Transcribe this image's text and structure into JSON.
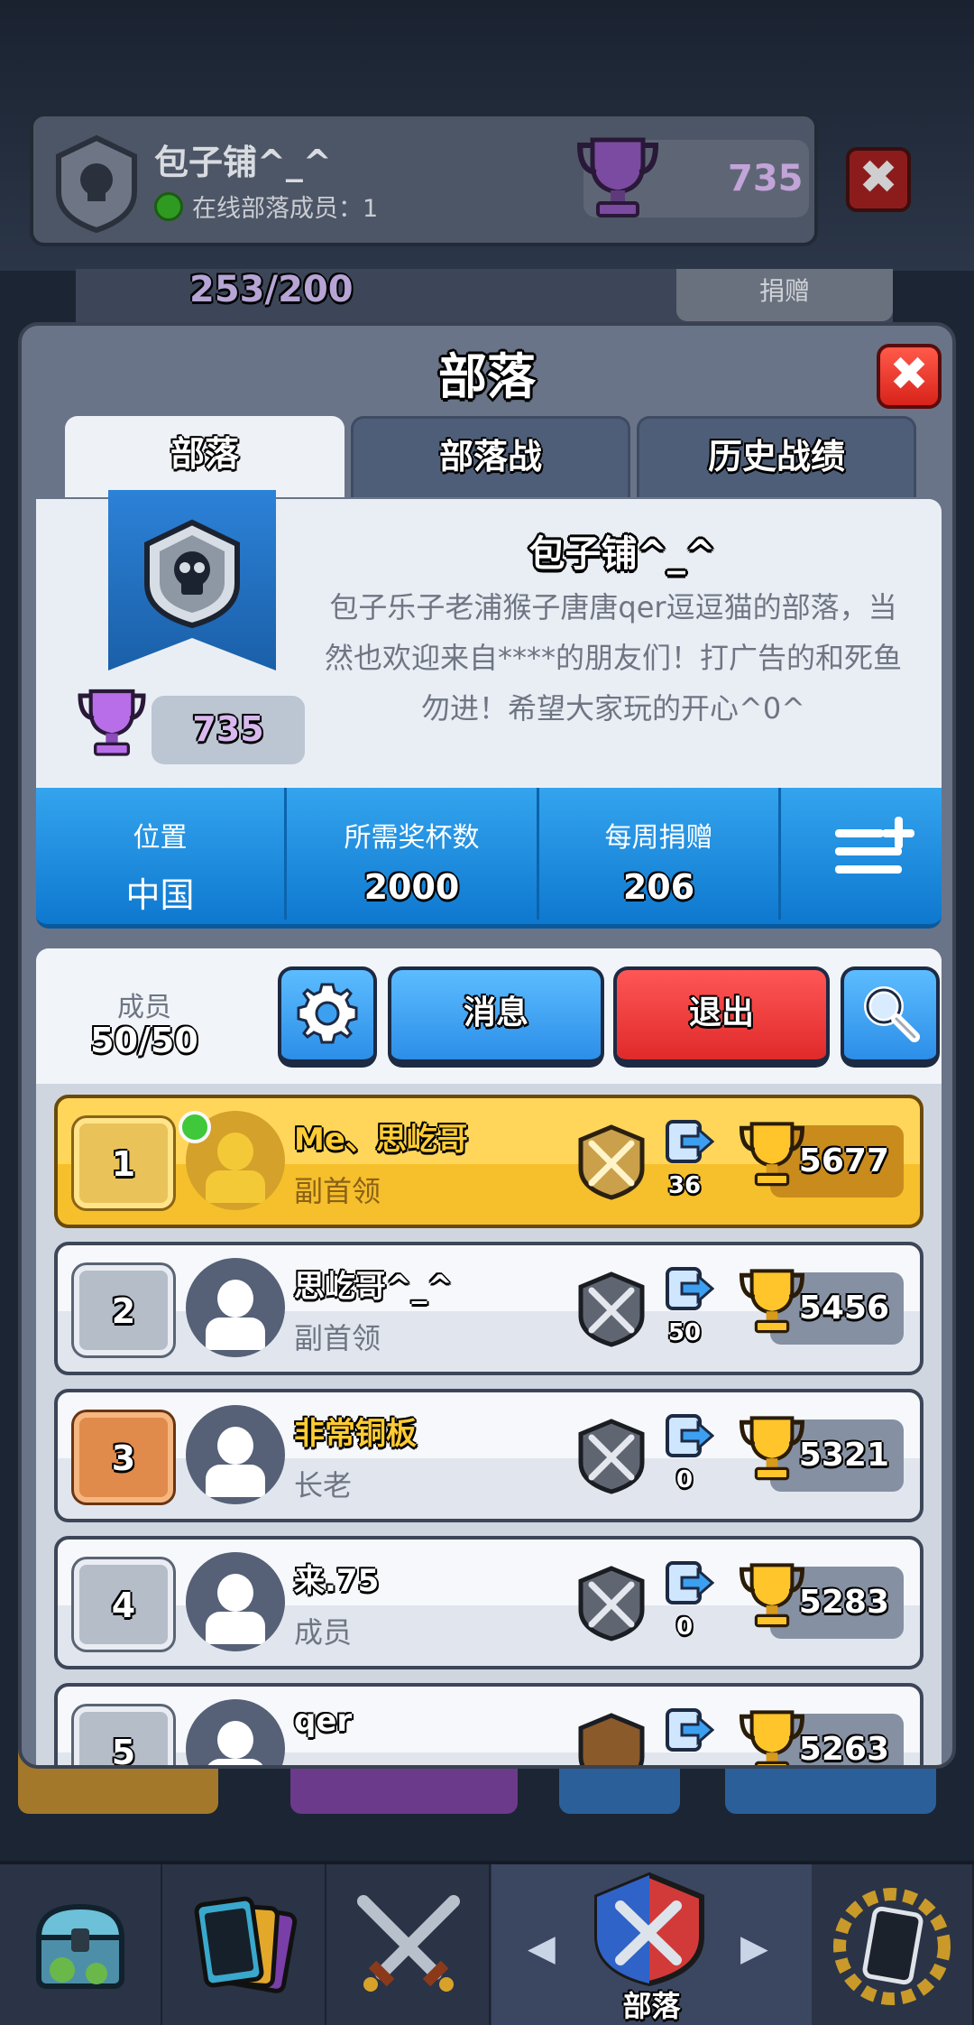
{
  "background": {
    "clan_name": "包子铺^_^",
    "online_label": "在线部落成员：1",
    "trophies": "735",
    "close_glyph": "✖",
    "donate_count": "253/200",
    "donate_button": "捐赠"
  },
  "modal": {
    "title": "部落",
    "close_glyph": "✖",
    "tabs": [
      {
        "label": "部落",
        "active": true
      },
      {
        "label": "部落战",
        "active": false
      },
      {
        "label": "历史战绩",
        "active": false
      }
    ]
  },
  "clan": {
    "name": "包子铺^_^",
    "description": "包子乐子老浦猴子唐唐qer逗逗猫的部落，当然也欢迎来自****的朋友们！打广告的和死鱼勿进！希望大家玩的开心^0^",
    "trophies": "735",
    "location_label": "位置",
    "location_value": "中国",
    "required_trophies_label": "所需奖杯数",
    "required_trophies_value": "2000",
    "weekly_donations_label": "每周捐赠",
    "weekly_donations_value": "206"
  },
  "members_header": {
    "label": "成员",
    "count": "50/50",
    "messages_button": "消息",
    "leave_button": "退出"
  },
  "members": [
    {
      "rank": "1",
      "name": "Me、思屹哥",
      "role": "副首领",
      "donations": "36",
      "trophies": "5677",
      "style": "gold",
      "online": true
    },
    {
      "rank": "2",
      "name": "思屹哥^_^",
      "role": "副首领",
      "donations": "50",
      "trophies": "5456",
      "style": "silver",
      "online": false
    },
    {
      "rank": "3",
      "name": "非常铜板",
      "role": "长老",
      "donations": "0",
      "trophies": "5321",
      "style": "bronze",
      "online": false
    },
    {
      "rank": "4",
      "name": "来.75",
      "role": "成员",
      "donations": "0",
      "trophies": "5283",
      "style": "silver",
      "online": false
    },
    {
      "rank": "5",
      "name": "qer",
      "role": "",
      "donations": "",
      "trophies": "5263",
      "style": "silver",
      "online": false
    }
  ],
  "bottom_nav": {
    "active_label": "部落"
  },
  "colors": {
    "accent_blue": "#1a8ae0",
    "danger_red": "#e02a2a",
    "gold": "#f6bf2c",
    "trophy_purple": "#a35fd0"
  }
}
